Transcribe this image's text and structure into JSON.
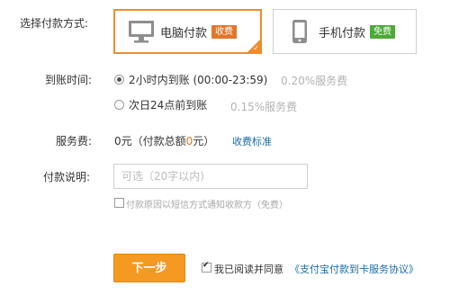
{
  "labels": {
    "payment_method": "选择付款方式:",
    "arrival_time": "到账时间:",
    "service_fee": "服务费:",
    "payment_note": "付款说明:"
  },
  "methods": {
    "pc": {
      "title": "电脑付款",
      "badge": "收费",
      "selected": true
    },
    "mobile": {
      "title": "手机付款",
      "badge": "免费",
      "selected": false
    }
  },
  "arrival_options": [
    {
      "label": "2小时内到账 (00:00-23:59)",
      "fee": "0.20%服务费",
      "selected": true
    },
    {
      "label": "次日24点前到账",
      "fee": "0.15%服务费",
      "selected": false
    }
  ],
  "service_fee": {
    "prefix": "0元（付款总额",
    "zero": "0",
    "suffix": "元）",
    "link": "收费标准"
  },
  "note": {
    "placeholder": "可选（20字以内)",
    "value": "",
    "sms_label": "付款原因以短信方式通知收款方（免费）",
    "sms_checked": false
  },
  "footer": {
    "next_button": "下一步",
    "agree_label": "我已阅读并同意",
    "agreement_link": "《支付宝付款到卡服务协议》",
    "agree_checked": true
  },
  "colors": {
    "accent": "#ec8c2e",
    "badge_orange": "#e2762a",
    "badge_green": "#4da93a",
    "link": "#1a6ea8",
    "button": "#f49a22"
  }
}
